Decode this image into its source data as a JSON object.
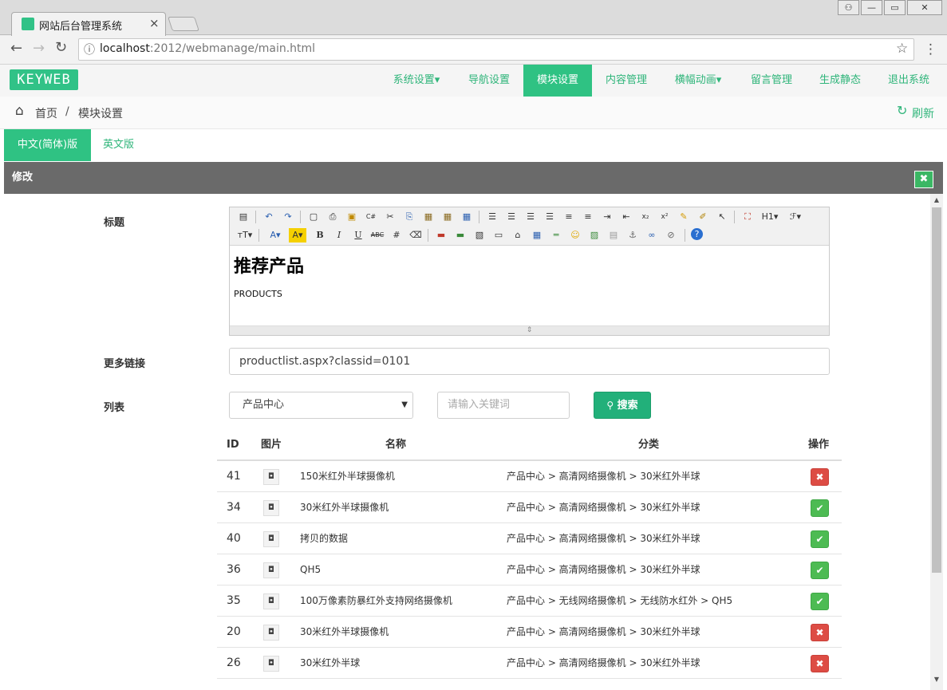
{
  "browser": {
    "tab_title": "网站后台管理系统",
    "tab_close": "×",
    "url_host": "localhost",
    "url_rest": ":2012/webmanage/main.html",
    "back": "←",
    "forward": "→",
    "reload": "↻",
    "info": "ⓘ",
    "star": "☆",
    "menu": "⋮",
    "win_user": "⚇",
    "win_min": "—",
    "win_max": "▭",
    "win_close": "✕"
  },
  "navbar": {
    "logo": "KEYWEB",
    "items": [
      {
        "label": "系统设置▾",
        "active": false
      },
      {
        "label": "导航设置",
        "active": false
      },
      {
        "label": "模块设置",
        "active": true
      },
      {
        "label": "内容管理",
        "active": false
      },
      {
        "label": "横幅动画▾",
        "active": false
      },
      {
        "label": "留言管理",
        "active": false
      },
      {
        "label": "生成静态",
        "active": false
      },
      {
        "label": "退出系统",
        "active": false
      }
    ]
  },
  "breadcrumb": {
    "home": "首页",
    "sep": "/",
    "current": "模块设置",
    "refresh": "刷新",
    "home_icon": "⌂",
    "refresh_icon": "↻"
  },
  "lang_tabs": [
    "中文(简体)版",
    "英文版"
  ],
  "panel": {
    "title": "修改",
    "close_icon": "✖"
  },
  "form": {
    "title_label": "标题",
    "more_link_label": "更多链接",
    "list_label": "列表",
    "editor_heading": "推荐产品",
    "editor_text": "PRODUCTS",
    "more_link_value": "productlist.aspx?classid=0101",
    "category_selected": "产品中心",
    "keyword_placeholder": "请输入关键词",
    "search_label": "搜索",
    "search_icon": "🔍"
  },
  "table": {
    "headers": [
      "ID",
      "图片",
      "名称",
      "分类",
      "操作"
    ],
    "rows": [
      {
        "id": "41",
        "name": "150米红外半球摄像机",
        "category": "产品中心 > 高清网络摄像机 > 30米红外半球",
        "status": "del"
      },
      {
        "id": "34",
        "name": "30米红外半球摄像机",
        "category": "产品中心 > 高清网络摄像机 > 30米红外半球",
        "status": "ok"
      },
      {
        "id": "40",
        "name": "拷贝的数据",
        "category": "产品中心 > 高清网络摄像机 > 30米红外半球",
        "status": "ok"
      },
      {
        "id": "36",
        "name": "QH5",
        "category": "产品中心 > 高清网络摄像机 > 30米红外半球",
        "status": "ok"
      },
      {
        "id": "35",
        "name": "100万像素防暴红外支持网络摄像机",
        "category": "产品中心 > 无线网络摄像机 > 无线防水红外 > QH5",
        "status": "ok"
      },
      {
        "id": "20",
        "name": "30米红外半球摄像机",
        "category": "产品中心 > 高清网络摄像机 > 30米红外半球",
        "status": "del"
      },
      {
        "id": "26",
        "name": "30米红外半球",
        "category": "产品中心 > 高清网络摄像机 > 30米红外半球",
        "status": "del"
      }
    ]
  },
  "colors": {
    "accent": "#2fc283",
    "panel": "#6a6a6a",
    "danger": "#dd4c44",
    "success": "#4dbb53"
  }
}
